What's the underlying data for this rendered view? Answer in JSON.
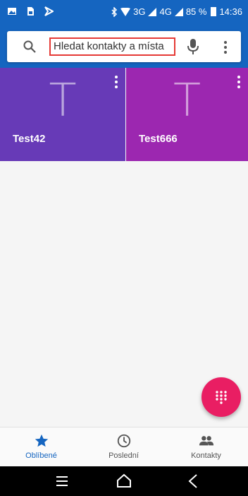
{
  "status_bar": {
    "network": "3G",
    "network2": "4G",
    "battery": "85 %",
    "time": "14:36"
  },
  "search": {
    "placeholder": "Hledat kontakty a místa"
  },
  "favorites": [
    {
      "initial": "T",
      "name": "Test42",
      "color": "#673ab7"
    },
    {
      "initial": "T",
      "name": "Test666",
      "color": "#9c27b0"
    }
  ],
  "bottom_nav": [
    {
      "label": "Oblíbené",
      "icon": "star-icon",
      "active": true
    },
    {
      "label": "Poslední",
      "icon": "clock-icon",
      "active": false
    },
    {
      "label": "Kontakty",
      "icon": "people-icon",
      "active": false
    }
  ],
  "colors": {
    "primary": "#1565c0",
    "fab": "#e91e63",
    "highlight": "#e53935"
  }
}
